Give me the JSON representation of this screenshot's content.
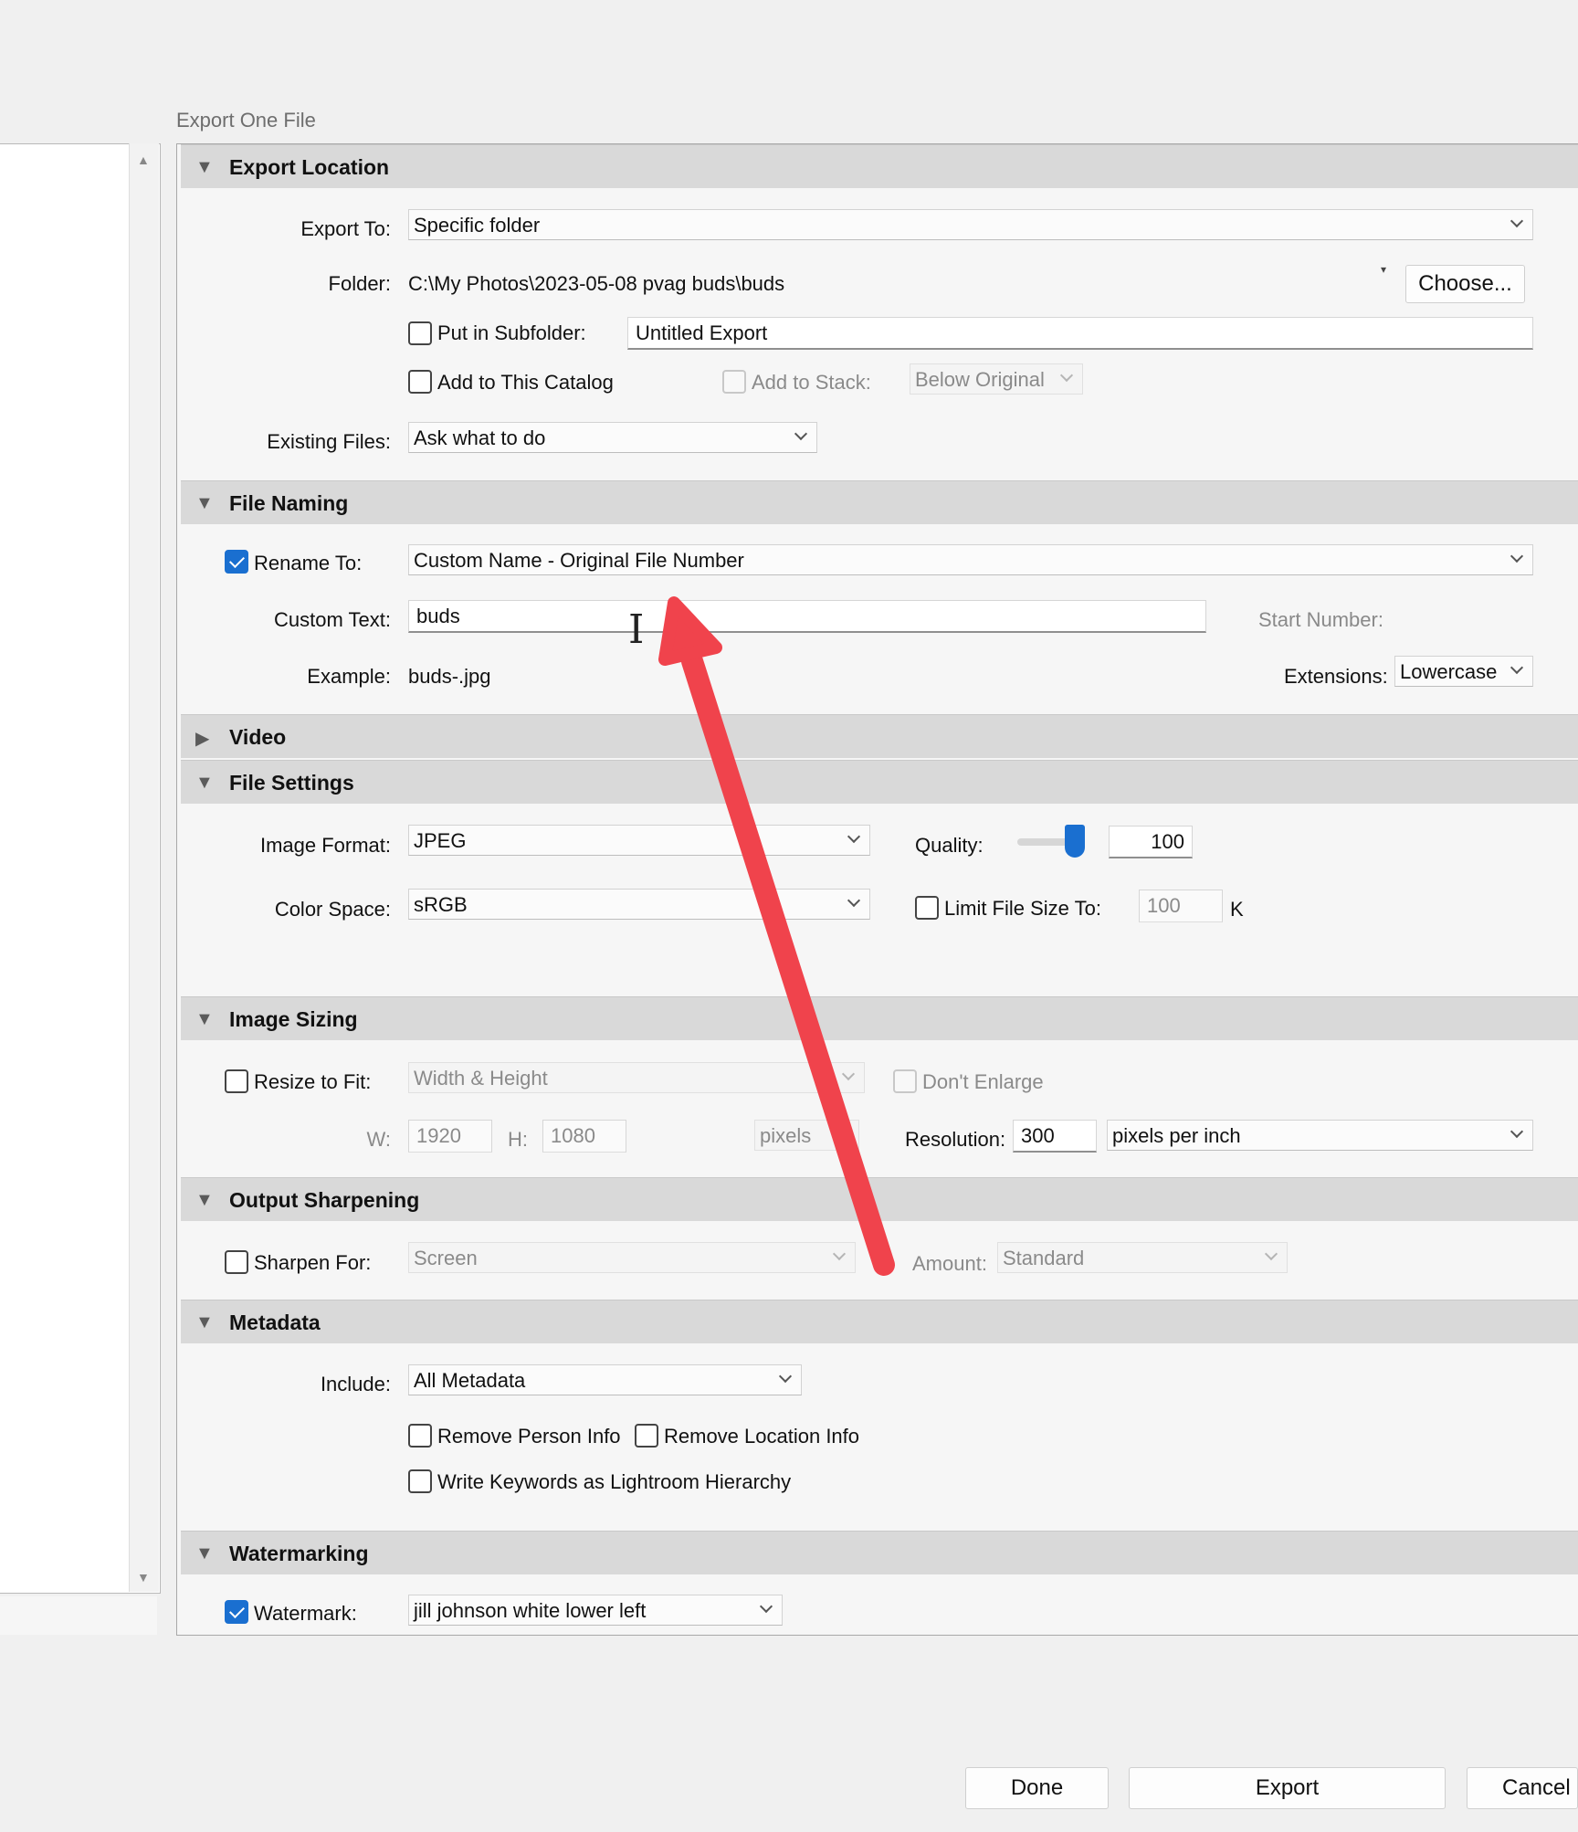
{
  "dialog": {
    "title": "Export One File"
  },
  "sections": {
    "export_location": {
      "title": "Export Location",
      "export_to": {
        "label": "Export To:",
        "value": "Specific folder"
      },
      "folder": {
        "label": "Folder:",
        "path": "C:\\My Photos\\2023-05-08 pvag buds\\buds",
        "choose_button": "Choose..."
      },
      "subfolder": {
        "label": "Put in Subfolder:",
        "checked": false,
        "value": "Untitled Export"
      },
      "add_to_catalog": {
        "label": "Add to This Catalog",
        "checked": false
      },
      "add_to_stack": {
        "label": "Add to Stack:",
        "checked": false,
        "value": "Below Original"
      },
      "existing_files": {
        "label": "Existing Files:",
        "value": "Ask what to do"
      }
    },
    "file_naming": {
      "title": "File Naming",
      "rename_to": {
        "label": "Rename To:",
        "checked": true,
        "value": "Custom Name - Original File Number"
      },
      "custom_text": {
        "label": "Custom Text:",
        "value": "buds"
      },
      "start_number": {
        "label": "Start Number:"
      },
      "example": {
        "label": "Example:",
        "value": "buds-.jpg"
      },
      "extensions": {
        "label": "Extensions:",
        "value": "Lowercase"
      }
    },
    "video": {
      "title": "Video"
    },
    "file_settings": {
      "title": "File Settings",
      "image_format": {
        "label": "Image Format:",
        "value": "JPEG"
      },
      "quality": {
        "label": "Quality:",
        "value": "100",
        "level_fraction": 1.0
      },
      "color_space": {
        "label": "Color Space:",
        "value": "sRGB"
      },
      "limit_file_size": {
        "label": "Limit File Size To:",
        "checked": false,
        "value": "100",
        "unit": "K"
      }
    },
    "image_sizing": {
      "title": "Image Sizing",
      "resize_to_fit": {
        "label": "Resize to Fit:",
        "checked": false,
        "value": "Width & Height"
      },
      "dont_enlarge": {
        "label": "Don't Enlarge",
        "checked": false
      },
      "w": {
        "label": "W:",
        "value": "1920"
      },
      "h": {
        "label": "H:",
        "value": "1080"
      },
      "units": "pixels",
      "resolution": {
        "label": "Resolution:",
        "value": "300",
        "unit": "pixels per inch"
      }
    },
    "output_sharpening": {
      "title": "Output Sharpening",
      "sharpen_for": {
        "label": "Sharpen For:",
        "checked": false,
        "value": "Screen"
      },
      "amount": {
        "label": "Amount:",
        "value": "Standard"
      }
    },
    "metadata": {
      "title": "Metadata",
      "include": {
        "label": "Include:",
        "value": "All Metadata"
      },
      "remove_person": {
        "label": "Remove Person Info",
        "checked": false
      },
      "remove_location": {
        "label": "Remove Location Info",
        "checked": false
      },
      "write_keywords": {
        "label": "Write Keywords as Lightroom Hierarchy",
        "checked": false
      }
    },
    "watermarking": {
      "title": "Watermarking",
      "watermark": {
        "label": "Watermark:",
        "checked": true,
        "value": "jill johnson white lower left"
      }
    }
  },
  "footer": {
    "done": "Done",
    "export": "Export",
    "cancel": "Cancel"
  },
  "annotation": {
    "arrow_color": "#f0434c"
  },
  "colors": {
    "accent": "#1a6fd0",
    "section_header": "#d9d9d9"
  }
}
